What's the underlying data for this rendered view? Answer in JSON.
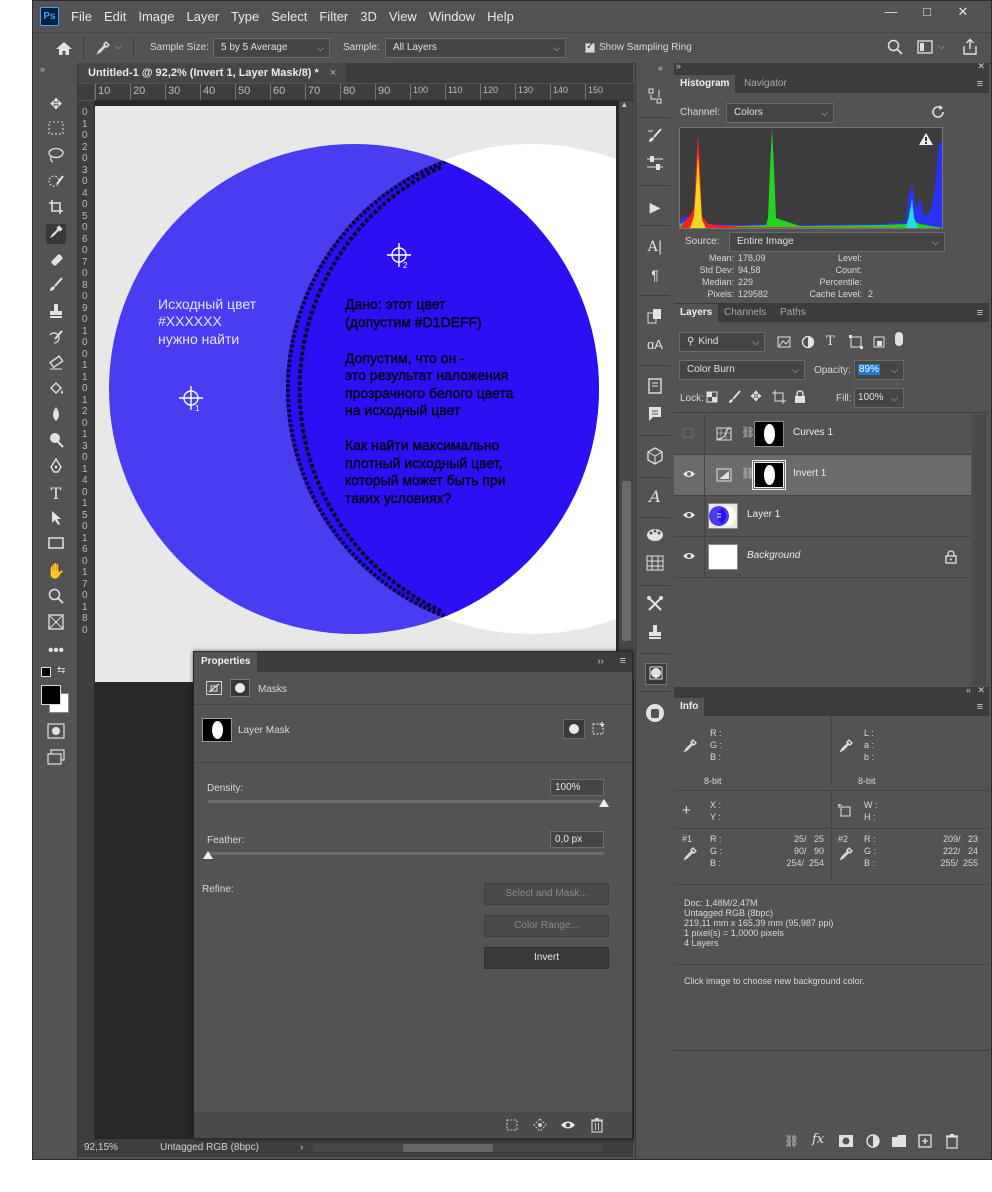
{
  "app": {
    "logo": "Ps"
  },
  "menu": [
    "File",
    "Edit",
    "Image",
    "Layer",
    "Type",
    "Select",
    "Filter",
    "3D",
    "View",
    "Window",
    "Help"
  ],
  "window_controls": [
    "—",
    "□",
    "✕"
  ],
  "options_bar": {
    "sample_size_label": "Sample Size:",
    "sample_size_value": "5 by 5 Average",
    "sample_label": "Sample:",
    "sample_value": "All Layers",
    "show_ring_label": "Show Sampling Ring"
  },
  "document": {
    "tab_title": "Untitled-1 @ 92,2% (Invert 1, Layer Mask/8) *",
    "ruler_top": [
      "10",
      "20",
      "30",
      "40",
      "50",
      "60",
      "70",
      "80",
      "90",
      "100",
      "110",
      "120",
      "130",
      "140",
      "150"
    ],
    "ruler_left": [
      "0",
      "1",
      "0",
      "2",
      "0",
      "3",
      "0",
      "4",
      "0",
      "5",
      "0",
      "6",
      "0",
      "7",
      "0",
      "8",
      "0",
      "9",
      "0",
      "1",
      "0",
      "0",
      "1",
      "1",
      "0",
      "1",
      "2",
      "0",
      "1",
      "3",
      "0",
      "1",
      "4",
      "0",
      "1",
      "5",
      "0",
      "1",
      "6",
      "0",
      "1",
      "7",
      "0",
      "1",
      "8",
      "0"
    ],
    "canvas_text_left": [
      "Исходный цвет",
      "#XXXXXX",
      "нужно найти"
    ],
    "canvas_text_right_p1": [
      "Дано: этот цвет",
      "(допустим #D1DEFF)"
    ],
    "canvas_text_right_p2": [
      "Допустим, что он -",
      "это результат наложения",
      "прозрачного белого цвета",
      "на исходный цвет"
    ],
    "canvas_text_right_p3": [
      "Как найти максимально",
      "плотный исходный цвет,",
      "который может быть при",
      "таких условиях?"
    ],
    "sampler_1": "1",
    "sampler_2": "2",
    "colors": {
      "blue": "#4a3cf0",
      "blue_inner": "#2a10f2",
      "light": "#e8e8e8"
    },
    "zoom": "92,15%",
    "status_profile": "Untagged RGB (8bpc)"
  },
  "properties": {
    "tab": "Properties",
    "section": "Masks",
    "layer_mask_label": "Layer Mask",
    "density_label": "Density:",
    "density_value": "100%",
    "density_level": 1.0,
    "feather_label": "Feather:",
    "feather_value": "0,0 px",
    "feather_level": 0.0,
    "refine_label": "Refine:",
    "btn_select_mask": "Select and Mask...",
    "btn_color_range": "Color Range...",
    "btn_invert": "Invert"
  },
  "histogram": {
    "tabs": [
      "Histogram",
      "Navigator"
    ],
    "channel_label": "Channel:",
    "channel_value": "Colors",
    "source_label": "Source:",
    "source_value": "Entire Image",
    "stats_left_labels": [
      "Mean:",
      "Std Dev:",
      "Median:",
      "Pixels:"
    ],
    "stats_left_values": [
      "178,09",
      "94,58",
      "229",
      "129582"
    ],
    "stats_right_labels": [
      "Level:",
      "Count:",
      "Percentile:",
      "Cache Level:"
    ],
    "stats_right_values": [
      "",
      "",
      "",
      "2"
    ]
  },
  "layers": {
    "tabs": [
      "Layers",
      "Channels",
      "Paths"
    ],
    "kind_value": "Kind",
    "blend_mode": "Color Burn",
    "opacity_label": "Opacity:",
    "opacity_value": "89%",
    "lock_label": "Lock:",
    "fill_label": "Fill:",
    "fill_value": "100%",
    "rows": [
      {
        "name": "Curves 1",
        "visible": false,
        "selected": false
      },
      {
        "name": "Invert 1",
        "visible": true,
        "selected": true
      },
      {
        "name": "Layer 1",
        "visible": true,
        "selected": false
      },
      {
        "name": "Background",
        "visible": true,
        "selected": false
      }
    ]
  },
  "info": {
    "tab": "Info",
    "rgb_labels": [
      "R :",
      "G :",
      "B :"
    ],
    "lab_labels": [
      "L :",
      "a :",
      "b :"
    ],
    "bit_left": "8-bit",
    "bit_right": "8-bit",
    "xy_labels": [
      "X :",
      "Y :"
    ],
    "wh_labels": [
      "W :",
      "H :"
    ],
    "sample1_id": "#1",
    "sample1_values": [
      "25/   25",
      "90/   90",
      "254/  254"
    ],
    "sample2_id": "#2",
    "sample2_values": [
      "209/   23",
      "222/   24",
      "255/  255"
    ],
    "doc_lines": [
      "Doc: 1,48M/2,47M",
      "Untagged RGB (8bpc)",
      "219,11 mm x 165,39 mm (95,987 ppi)",
      "1 pixel(s) = 1,0000 pixels",
      "4 Layers"
    ],
    "hint": "Click image to choose new background color."
  }
}
